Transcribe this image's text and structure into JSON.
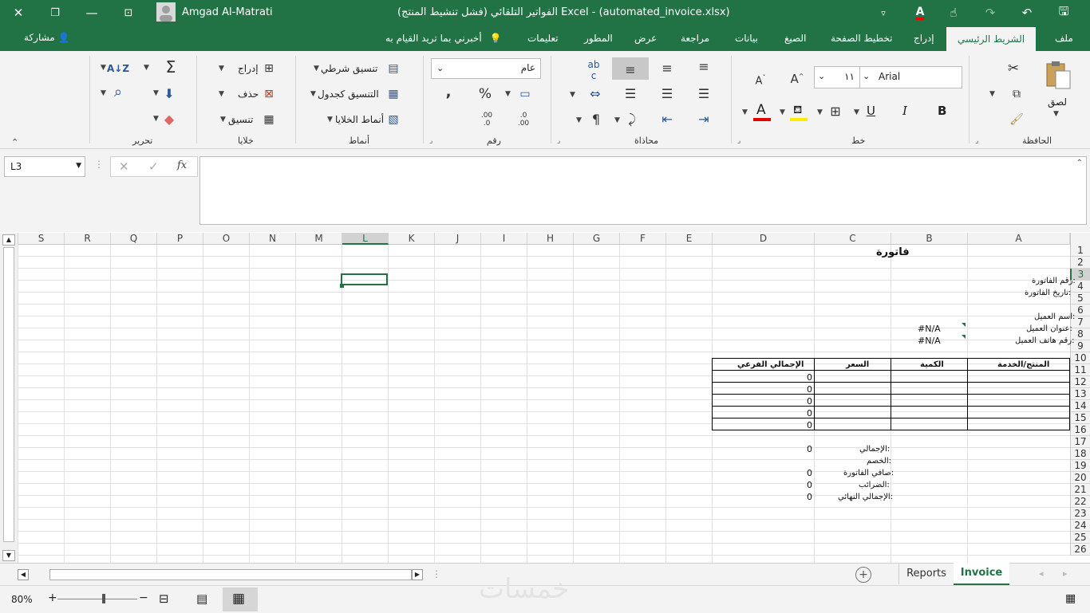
{
  "window": {
    "title": "الفواتير التلقائي (فشل تنشيط المنتج) Excel  -  (automated_invoice.xlsx)",
    "user": "Amgad Al-Matrati"
  },
  "tabs": [
    {
      "label": "ملف"
    },
    {
      "label": "الشريط الرئيسي"
    },
    {
      "label": "إدراج"
    },
    {
      "label": "تخطيط الصفحة"
    },
    {
      "label": "الصيغ"
    },
    {
      "label": "بيانات"
    },
    {
      "label": "مراجعة"
    },
    {
      "label": "عرض"
    },
    {
      "label": "المطور"
    },
    {
      "label": "تعليمات"
    }
  ],
  "tell_me": "أخبرني بما تريد القيام به",
  "share": "مشاركة",
  "ribbon": {
    "clipboard": {
      "label": "الحافظة",
      "paste": "لصق"
    },
    "font": {
      "label": "خط",
      "name": "Arial",
      "size": "١١",
      "bold": "B",
      "italic": "I",
      "underline": "U"
    },
    "alignment": {
      "label": "محاذاة"
    },
    "number": {
      "label": "رقم",
      "format": "عام"
    },
    "styles": {
      "label": "أنماط",
      "conditional": "تنسيق شرطي",
      "as_table": "التنسيق كجدول",
      "cell_styles": "أنماط الخلايا"
    },
    "cells": {
      "label": "خلايا",
      "insert": "إدراج",
      "delete": "حذف",
      "format": "تنسيق"
    },
    "editing": {
      "label": "تحرير"
    }
  },
  "formula_bar": {
    "name_box": "L3",
    "formula": ""
  },
  "columns": [
    "A",
    "B",
    "C",
    "D",
    "E",
    "F",
    "G",
    "H",
    "I",
    "J",
    "K",
    "L",
    "M",
    "N",
    "O",
    "P",
    "Q",
    "R",
    "S"
  ],
  "rows": [
    "1",
    "2",
    "3",
    "4",
    "5",
    "6",
    "7",
    "8",
    "9",
    "10",
    "11",
    "12",
    "13",
    "14",
    "15",
    "16",
    "17",
    "18",
    "19",
    "20",
    "21",
    "22",
    "23",
    "24",
    "25",
    "26"
  ],
  "sheet": {
    "title": "فاتورة",
    "invoice_number": "رقم الفاتورة:",
    "invoice_date": "تاريخ الفاتورة:",
    "customer_name": "اسم العميل:",
    "customer_address": "عنوان العميل:",
    "customer_phone": "رقم هاتف العميل:",
    "na_1": "#N/A",
    "na_2": "#N/A",
    "table_headers": [
      "المنتج/الخدمة",
      "الكمية",
      "السعر",
      "الإجمالي الفرعي"
    ],
    "subtotals": [
      "0",
      "0",
      "0",
      "0",
      "0"
    ],
    "total_label": "الإجمالي:",
    "discount_label": "الخصم:",
    "net_label": "صافي الفاتورة:",
    "tax_label": "الضرائب:",
    "grand_label": "الإجمالي النهائي:",
    "total_val": "0",
    "net_val": "0",
    "tax_val": "0",
    "grand_val": "0"
  },
  "sheet_tabs": [
    {
      "label": "Invoice",
      "active": true
    },
    {
      "label": "Reports",
      "active": false
    }
  ],
  "status": {
    "zoom": "80%"
  },
  "watermark": "خمسات"
}
